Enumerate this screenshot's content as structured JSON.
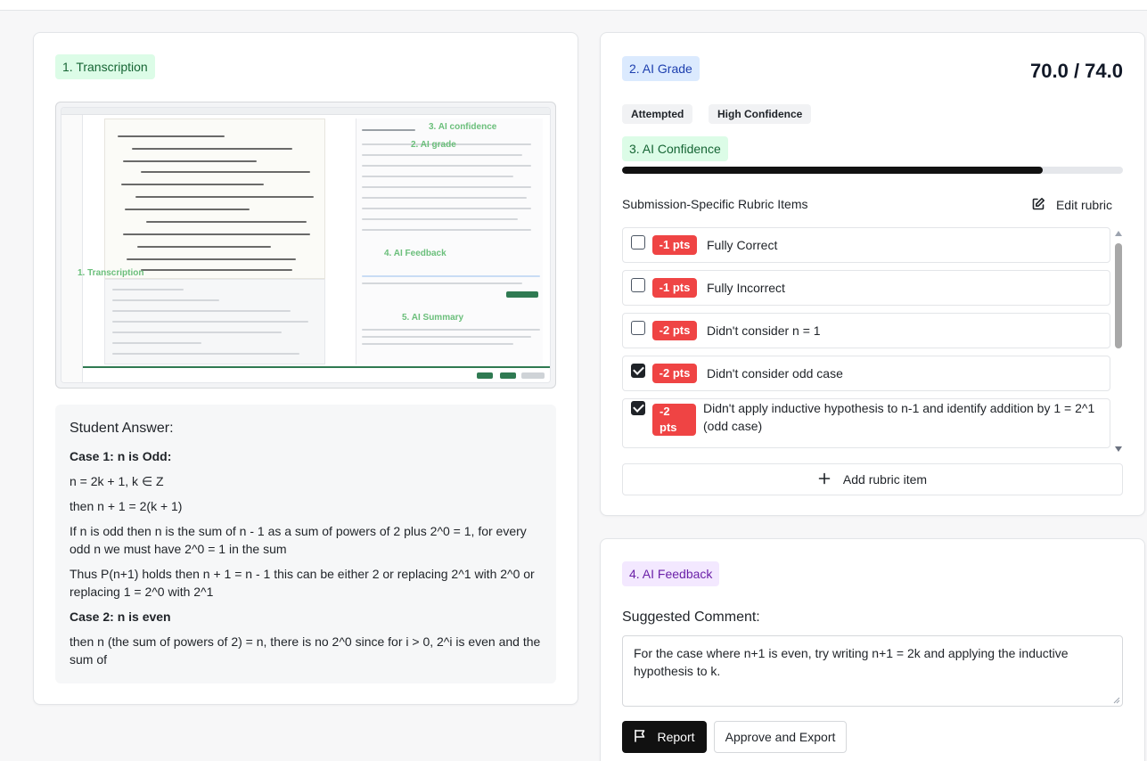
{
  "transcription": {
    "tag": "1. Transcription",
    "screenshot_labels": {
      "confidence": "3. AI confidence",
      "grade": "2. AI grade",
      "transcription": "1. Transcription",
      "feedback": "4. AI Feedback",
      "summary": "5. AI Summary"
    },
    "answer": {
      "title": "Student Answer:",
      "paragraphs": [
        {
          "text": "Case 1: n is Odd:",
          "bold": true
        },
        {
          "text": "n = 2k + 1, k ∈ Z",
          "bold": false
        },
        {
          "text": "then n + 1 = 2(k + 1)",
          "bold": false
        },
        {
          "text": "If n is odd then n is the sum of n - 1 as a sum of powers of 2 plus 2^0 = 1, for every odd n we must have 2^0 = 1 in the sum",
          "bold": false
        },
        {
          "text": "Thus P(n+1) holds then n + 1 = n - 1 this can be either 2 or replacing 2^1 with 2^0 or replacing 1 = 2^0 with 2^1",
          "bold": false
        },
        {
          "text": "Case 2: n is even",
          "bold": true
        },
        {
          "text": "then n (the sum of powers of 2) = n, there is no 2^0 since for i > 0, 2^i is even and the sum of",
          "bold": false
        }
      ]
    }
  },
  "grade": {
    "tag": "2. AI Grade",
    "score": "70.0 / 74.0",
    "pills": [
      "Attempted",
      "High Confidence"
    ],
    "confidence_tag": "3. AI Confidence",
    "confidence_fraction": 0.84,
    "rubric_heading": "Submission-Specific Rubric Items",
    "edit_label": "Edit rubric",
    "items": [
      {
        "points": "-1 pts",
        "label": "Fully Correct",
        "checked": false
      },
      {
        "points": "-1 pts",
        "label": "Fully Incorrect",
        "checked": false
      },
      {
        "points": "-2 pts",
        "label": "Didn't consider n = 1",
        "checked": false
      },
      {
        "points": "-2 pts",
        "label": "Didn't consider odd case",
        "checked": true
      },
      {
        "points": "-2 pts",
        "label": "Didn't apply inductive hypothesis to n-1 and identify addition by 1 = 2^1 (odd case)",
        "checked": true
      }
    ],
    "add_label": "Add rubric item"
  },
  "feedback": {
    "tag": "4. AI Feedback",
    "label": "Suggested Comment:",
    "comment": "For the case where n+1 is even, try writing n+1 = 2k and applying the inductive hypothesis to k.",
    "report_label": "Report",
    "approve_label": "Approve and Export"
  },
  "colors": {
    "penalty": "#ef4444",
    "green_tag": "#dcfce7",
    "blue_tag": "#dbeafe",
    "purple_tag": "#f3e8ff",
    "primary": "#111111"
  },
  "icons": [
    "pencil-square-icon",
    "plus-icon",
    "flag-icon",
    "scroll-up-icon",
    "scroll-down-icon"
  ]
}
